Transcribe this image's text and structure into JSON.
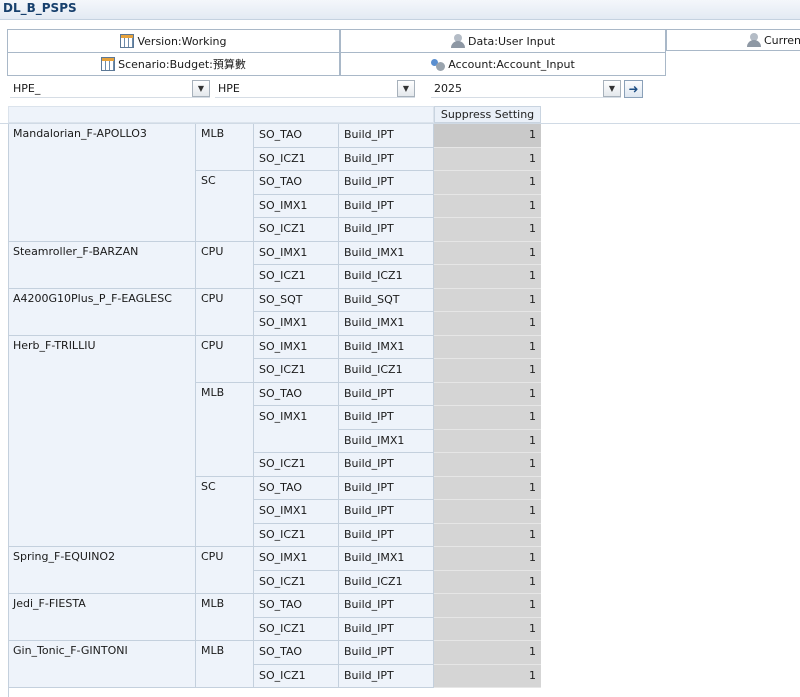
{
  "title": "DL_B_PSPS",
  "pov": {
    "version": "Version:Working",
    "data": "Data:User Input",
    "currency": "Currency",
    "scenario": "Scenario:Budget:預算數",
    "account": "Account:Account_Input"
  },
  "selectors": [
    {
      "value": "HPE_"
    },
    {
      "value": "HPE"
    },
    {
      "value": "2025"
    }
  ],
  "column_header": "Suppress Setting",
  "products": [
    {
      "name": "Mandalorian_F-APOLLO3",
      "rows": 5
    },
    {
      "name": "Steamroller_F-BARZAN",
      "rows": 2
    },
    {
      "name": "A4200G10Plus_P_F-EAGLESC",
      "rows": 2
    },
    {
      "name": "Herb_F-TRILLIU",
      "rows": 9
    },
    {
      "name": "Spring_F-EQUINO2",
      "rows": 2
    },
    {
      "name": "Jedi_F-FIESTA",
      "rows": 2
    },
    {
      "name": "Gin_Tonic_F-GINTONI",
      "rows": 2
    }
  ],
  "categories": [
    {
      "label": "MLB",
      "rows": 2
    },
    {
      "label": "SC",
      "rows": 3
    },
    {
      "label": "CPU",
      "rows": 2
    },
    {
      "label": "CPU",
      "rows": 2
    },
    {
      "label": "CPU",
      "rows": 2
    },
    {
      "label": "MLB",
      "rows": 4
    },
    {
      "label": "SC",
      "rows": 3
    },
    {
      "label": "CPU",
      "rows": 2
    },
    {
      "label": "MLB",
      "rows": 2
    },
    {
      "label": "MLB",
      "rows": 2
    }
  ],
  "so_groups": [
    {
      "label": "SO_TAO",
      "rows": 1
    },
    {
      "label": "SO_ICZ1",
      "rows": 1
    },
    {
      "label": "SO_TAO",
      "rows": 1
    },
    {
      "label": "SO_IMX1",
      "rows": 1
    },
    {
      "label": "SO_ICZ1",
      "rows": 1
    },
    {
      "label": "SO_IMX1",
      "rows": 1
    },
    {
      "label": "SO_ICZ1",
      "rows": 1
    },
    {
      "label": "SO_SQT",
      "rows": 1
    },
    {
      "label": "SO_IMX1",
      "rows": 1
    },
    {
      "label": "SO_IMX1",
      "rows": 1
    },
    {
      "label": "SO_ICZ1",
      "rows": 1
    },
    {
      "label": "SO_TAO",
      "rows": 1
    },
    {
      "label": "SO_IMX1",
      "rows": 2
    },
    {
      "label": "SO_ICZ1",
      "rows": 1
    },
    {
      "label": "SO_TAO",
      "rows": 1
    },
    {
      "label": "SO_IMX1",
      "rows": 1
    },
    {
      "label": "SO_ICZ1",
      "rows": 1
    },
    {
      "label": "SO_IMX1",
      "rows": 1
    },
    {
      "label": "SO_ICZ1",
      "rows": 1
    },
    {
      "label": "SO_TAO",
      "rows": 1
    },
    {
      "label": "SO_ICZ1",
      "rows": 1
    },
    {
      "label": "SO_TAO",
      "rows": 1
    },
    {
      "label": "SO_ICZ1",
      "rows": 1
    }
  ],
  "rows": [
    {
      "build": "Build_IPT",
      "value": "1"
    },
    {
      "build": "Build_IPT",
      "value": "1"
    },
    {
      "build": "Build_IPT",
      "value": "1"
    },
    {
      "build": "Build_IPT",
      "value": "1"
    },
    {
      "build": "Build_IPT",
      "value": "1"
    },
    {
      "build": "Build_IMX1",
      "value": "1"
    },
    {
      "build": "Build_ICZ1",
      "value": "1"
    },
    {
      "build": "Build_SQT",
      "value": "1"
    },
    {
      "build": "Build_IMX1",
      "value": "1"
    },
    {
      "build": "Build_IMX1",
      "value": "1"
    },
    {
      "build": "Build_ICZ1",
      "value": "1"
    },
    {
      "build": "Build_IPT",
      "value": "1"
    },
    {
      "build": "Build_IPT",
      "value": "1"
    },
    {
      "build": "Build_IMX1",
      "value": "1"
    },
    {
      "build": "Build_IPT",
      "value": "1"
    },
    {
      "build": "Build_IPT",
      "value": "1"
    },
    {
      "build": "Build_IPT",
      "value": "1"
    },
    {
      "build": "Build_IPT",
      "value": "1"
    },
    {
      "build": "Build_IMX1",
      "value": "1"
    },
    {
      "build": "Build_ICZ1",
      "value": "1"
    },
    {
      "build": "Build_IPT",
      "value": "1"
    },
    {
      "build": "Build_IPT",
      "value": "1"
    },
    {
      "build": "Build_IPT",
      "value": "1"
    },
    {
      "build": "Build_IPT",
      "value": "1"
    }
  ]
}
